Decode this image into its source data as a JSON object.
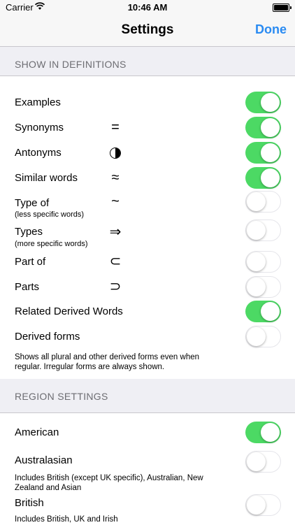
{
  "status_bar": {
    "carrier": "Carrier",
    "time": "10:46 AM"
  },
  "nav": {
    "title": "Settings",
    "done_label": "Done"
  },
  "definitions_section": {
    "header": "SHOW IN DEFINITIONS",
    "rows": [
      {
        "label": "Examples",
        "sublabel": "",
        "symbol": "",
        "on": true
      },
      {
        "label": "Synonyms",
        "sublabel": "",
        "symbol": "=",
        "on": true
      },
      {
        "label": "Antonyms",
        "sublabel": "",
        "symbol": "half-circle-icon",
        "on": true
      },
      {
        "label": "Similar words",
        "sublabel": "",
        "symbol": "≈",
        "on": true
      },
      {
        "label": "Type of",
        "sublabel": "(less specific words)",
        "symbol": "~",
        "on": false
      },
      {
        "label": "Types",
        "sublabel": "(more specific words)",
        "symbol": "⇒",
        "on": false
      },
      {
        "label": "Part of",
        "sublabel": "",
        "symbol": "⊂",
        "on": false
      },
      {
        "label": "Parts",
        "sublabel": "",
        "symbol": "⊃",
        "on": false
      },
      {
        "label": "Related Derived Words",
        "sublabel": "",
        "symbol": "",
        "on": true
      },
      {
        "label": "Derived forms",
        "sublabel": "",
        "symbol": "",
        "on": false
      }
    ],
    "derived_forms_note": "Shows all plural and other derived forms even when regular. Irregular forms are always shown."
  },
  "region_section": {
    "header": "REGION SETTINGS",
    "rows": [
      {
        "label": "American",
        "description": "",
        "on": true
      },
      {
        "label": "Australasian",
        "description": "Includes British (except UK specific), Australian, New Zealand and Asian",
        "on": false
      },
      {
        "label": "British",
        "description": "Includes British, UK and Irish",
        "on": false
      }
    ]
  },
  "colors": {
    "accent": "#2a8bf2",
    "toggle_on": "#4cd964",
    "background": "#efeff4",
    "header_text": "#6d6d72"
  }
}
